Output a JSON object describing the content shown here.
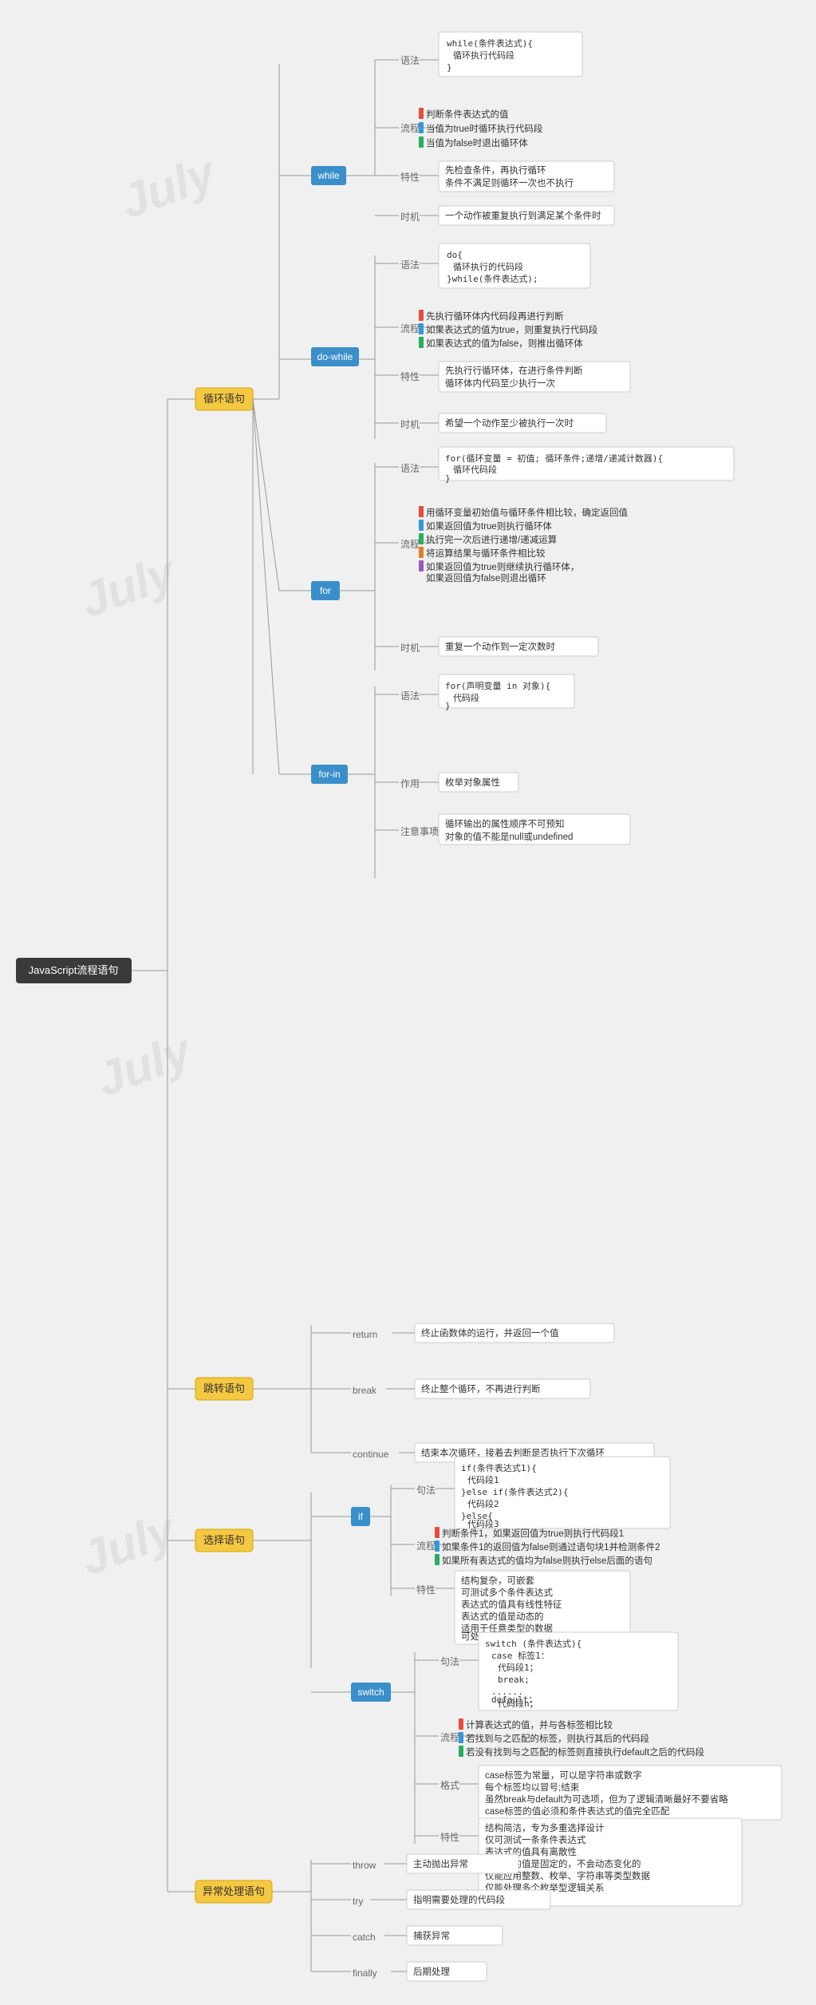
{
  "title": "JavaScript流程语句",
  "branches": {
    "loop": {
      "label": "循环语句",
      "while": {
        "syntax_label": "语法",
        "syntax_code": "while(条件表达式){\n    循环执行代码段\n}",
        "flow_label": "流程",
        "flow_items": [
          "判断条件表达式的值",
          "当值为true时循环执行代码段",
          "当值为false时退出循环体"
        ],
        "feature_label": "特性",
        "feature_text": "先检查条件，再执行循环\n条件不满足则循环一次也不执行",
        "timing_label": "时机",
        "timing_text": "一个动作被重复执行到满足某个条件时"
      },
      "dowhile": {
        "syntax_code": "do{\n    循环执行的代码段\n}while(条件表达式);",
        "flow_items": [
          "先执行循环体内代码段再进行判断",
          "如果表达式的值为true，则重复执行代码段",
          "如果表达式的值为false，则推出循环体"
        ],
        "feature_text": "先执行行循环体，在进行条件判断\n循环体内代码至少执行一次",
        "timing_text": "希望一个动作至少被执行一次时"
      },
      "for": {
        "syntax_code": "for(循环变量 = 初值; 循环条件;递增/递减计数器){\n    循环代码段\n}",
        "flow_items": [
          "用循环变量初始值与循环条件相比较，确定返回值",
          "如果返回值为true则执行循环体",
          "执行完一次后进行递增/递减运算",
          "将运算结果与循环条件相比较",
          "如果返回值为true则继续执行循环体，如果返回值为false则退出循环体"
        ],
        "timing_text": "重复一个动作到一定次数时"
      },
      "forin": {
        "syntax_code": "for(声明变量 in 对象){\n    代码段\n}",
        "action_label": "作用",
        "action_text": "枚举对象属性",
        "note_label": "注意事项",
        "note_text": "循环输出的属性顺序不可预知\n对象的值不能是null或undefined"
      }
    },
    "jump": {
      "label": "跳转语句",
      "return_text": "终止函数体的运行，并返回一个值",
      "break_text": "终止整个循环，不再进行判断",
      "continue_text": "结束本次循环，接着去判断是否执行下次循环"
    },
    "select": {
      "label": "选择语句",
      "if": {
        "syntax_code": "if(条件表达式1){\n    代码段1\n}else if(条件表达式2){\n    代码段2\n}else{\n    代码段3\n}",
        "flow_items": [
          "判断条件1，如果返回值为true则执行代码段1",
          "如果条件1的返回值为false则通过语句块1并检测条件2",
          "如果所有表达式的值均为false则执行else后面的语句"
        ],
        "feature_text": "结构复杂，可嵌套\n可测试多个条件表达式\n表达式的值具有线性特征\n表达式的值是动态的\n适用于任意类型的数据\n可处理复杂的逻辑关系"
      },
      "switch": {
        "syntax_code": "switch (条件表达式){\n    case 标签1：\n        代码段1；\n        break;\n    ......\n    default：\n        代码段n；\n}",
        "flow_items": [
          "计算表达式的值，并与各标签相比较",
          "若找到与之匹配的标签，则执行其后的代码段",
          "若没有找到与之匹配的标签则直接执行default之后的代码段"
        ],
        "format_label": "格式",
        "format_text": "case标签为常量，可以是字符串或数字\n每个标签均以冒号;结束\n虽然break与default为可选项，但为了逻辑清晰最好不要省略\ncase标签的值必须和条件表达式的值完全匹配",
        "feature_text": "结构简洁，专为多重选择设计\n仅可测试一条条件表达式\n表达式的值具有离散性\n表达式的值是固定的，不会动态变化的\n仅能应用整数、枚举、字符串等类型数据\n仅能处理多个枚举型逻辑关系"
      }
    },
    "exception": {
      "label": "异常处理语句",
      "throw_text": "主动抛出异常",
      "try_text": "指明需要处理的代码段",
      "catch_text": "捕获异常",
      "finally_text": "后期处理"
    }
  }
}
